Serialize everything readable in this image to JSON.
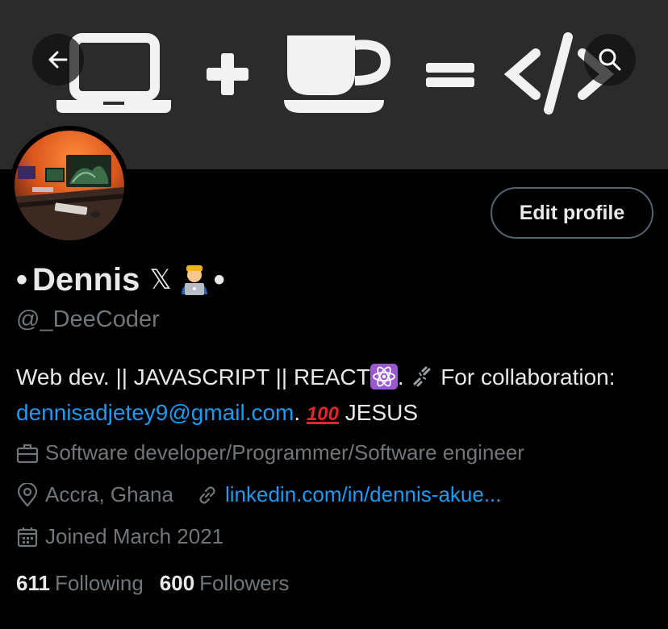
{
  "header": {
    "back_icon": "arrow-left-icon",
    "search_icon": "search-icon",
    "banner_description_icons": [
      "laptop-icon",
      "plus-icon",
      "coffee-cup-icon",
      "equals-icon",
      "code-icon"
    ]
  },
  "profile": {
    "name": "Dennis",
    "name_prefix": "•",
    "name_suffix": "•",
    "name_x_glyph": "𝕏",
    "handle": "@_DeeCoder",
    "edit_profile_label": "Edit profile",
    "bio": {
      "part1": "Web dev. || JAVASCRIPT || REACT",
      "part2": ".",
      "part3": "For collaboration:",
      "email": "dennisadjetey9@gmail.com",
      "part4": ".",
      "emoji_100": "100",
      "part5": "JESUS"
    },
    "occupation": "Software developer/Programmer/Software engineer",
    "location": "Accra, Ghana",
    "website": "linkedin.com/in/dennis-akue...",
    "joined": "Joined March 2021",
    "following_count": "611",
    "following_label": "Following",
    "followers_count": "600",
    "followers_label": "Followers"
  },
  "colors": {
    "background": "#000000",
    "banner": "#2b2b2c",
    "link": "#1d9bf0",
    "muted": "#71767b",
    "text": "#e7e9ea"
  }
}
